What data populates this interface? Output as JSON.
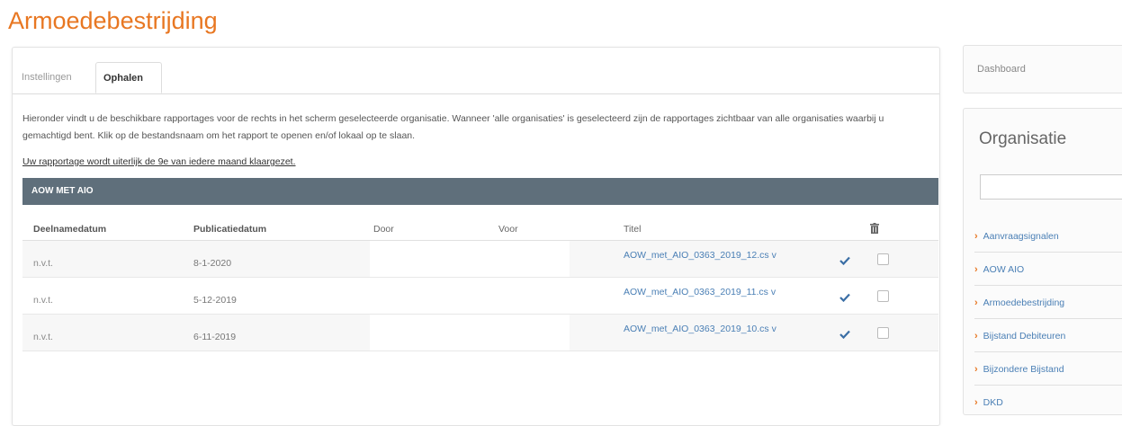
{
  "page_title": "Armoedebestrijding",
  "tabs": [
    {
      "label": "Instellingen",
      "active": false
    },
    {
      "label": "Ophalen",
      "active": true
    }
  ],
  "intro_text": "Hieronder vindt u de beschikbare rapportages voor de rechts in het scherm geselecteerde organisatie. Wanneer 'alle organisaties' is geselecteerd zijn de rapportages zichtbaar van alle organisaties waarbij u gemachtigd bent. Klik op de bestandsnaam om het rapport te openen en/of lokaal op te slaan.",
  "notice": "Uw rapportage wordt uiterlijk de 9e van iedere maand klaargezet.",
  "section_title": "AOW MET AIO",
  "columns": {
    "deelnamedatum": "Deelnamedatum",
    "publicatiedatum": "Publicatiedatum",
    "door": "Door",
    "voor": "Voor",
    "titel": "Titel"
  },
  "rows": [
    {
      "deelnamedatum": "n.v.t.",
      "publicatiedatum": "8-1-2020",
      "titel": "AOW_met_AIO_0363_2019_12.cs v"
    },
    {
      "deelnamedatum": "n.v.t.",
      "publicatiedatum": "5-12-2019",
      "titel": "AOW_met_AIO_0363_2019_11.cs v"
    },
    {
      "deelnamedatum": "n.v.t.",
      "publicatiedatum": "6-11-2019",
      "titel": "AOW_met_AIO_0363_2019_10.cs v"
    }
  ],
  "sidebar": {
    "dashboard_label": "Dashboard",
    "org_title": "Organisatie",
    "org_input_value": "",
    "items": [
      "Aanvraagsignalen",
      "AOW AIO",
      "Armoedebestrijding",
      "Bijstand Debiteuren",
      "Bijzondere Bijstand",
      "DKD"
    ]
  },
  "colors": {
    "accent": "#e87722",
    "link": "#4a7fb5",
    "section_bar": "#5f6f7b"
  },
  "icons": {
    "check": "check-icon",
    "trash": "trash-icon",
    "chevron": "chevron-right-icon"
  }
}
